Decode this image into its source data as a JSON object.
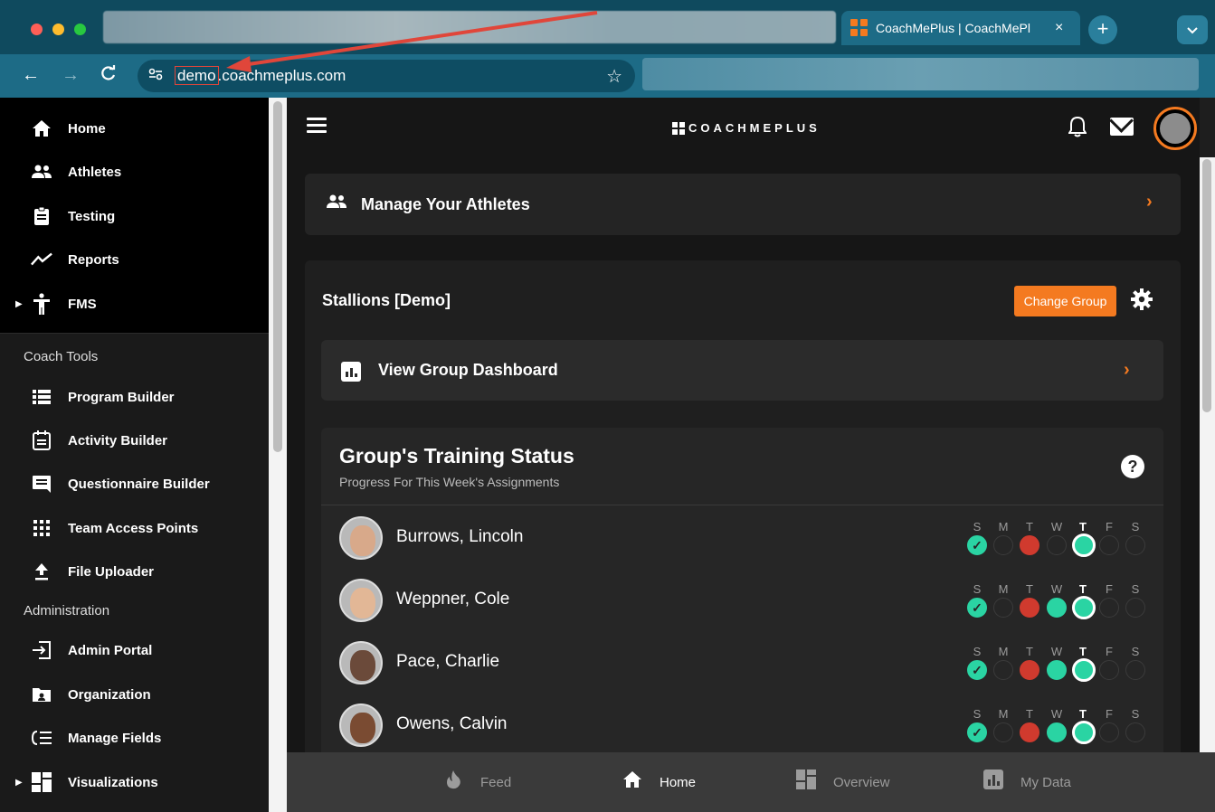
{
  "browser": {
    "tab_title": "CoachMePlus | CoachMePl",
    "tab_close": "×",
    "new_tab": "+",
    "tab_menu": "⌄",
    "url_highlight": "demo",
    "url_rest": ".coachmeplus.com",
    "back": "←",
    "forward": "→",
    "reload": "C",
    "site_info_icon": "⚯",
    "bookmark_icon": "☆"
  },
  "sidebar": {
    "items": [
      {
        "label": "Home",
        "icon": "home-icon"
      },
      {
        "label": "Athletes",
        "icon": "people-icon"
      },
      {
        "label": "Testing",
        "icon": "clipboard-icon"
      },
      {
        "label": "Reports",
        "icon": "trend-icon"
      },
      {
        "label": "FMS",
        "icon": "person-icon"
      }
    ],
    "section_coach": "Coach Tools",
    "coach_items": [
      {
        "label": "Program Builder",
        "icon": "list-icon"
      },
      {
        "label": "Activity Builder",
        "icon": "calendar-icon"
      },
      {
        "label": "Questionnaire Builder",
        "icon": "message-icon"
      },
      {
        "label": "Team Access Points",
        "icon": "grid-icon"
      },
      {
        "label": "File Uploader",
        "icon": "upload-icon"
      }
    ],
    "section_admin": "Administration",
    "admin_items": [
      {
        "label": "Admin Portal",
        "icon": "login-icon"
      },
      {
        "label": "Organization",
        "icon": "folder-icon"
      },
      {
        "label": "Manage Fields",
        "icon": "fields-icon"
      },
      {
        "label": "Visualizations",
        "icon": "dashboard-icon"
      }
    ]
  },
  "header": {
    "brand": "COACHMEPLUS"
  },
  "manage": {
    "label": "Manage Your Athletes",
    "chevron": "›"
  },
  "group": {
    "title": "Stallions [Demo]",
    "change_button": "Change Group",
    "dashboard_label": "View Group Dashboard",
    "chevron": "›"
  },
  "training": {
    "title": "Group's Training Status",
    "subtitle": "Progress For This Week's Assignments",
    "help": "?",
    "day_letters": [
      "S",
      "M",
      "T",
      "W",
      "T",
      "F",
      "S"
    ],
    "today_index": 4,
    "athletes": [
      {
        "name": "Burrows, Lincoln",
        "status": [
          "check",
          "empty",
          "red",
          "empty",
          "today",
          "empty",
          "empty"
        ],
        "skin": "#d8a98a"
      },
      {
        "name": "Weppner, Cole",
        "status": [
          "check",
          "empty",
          "red",
          "green",
          "today",
          "empty",
          "empty"
        ],
        "skin": "#e2b796"
      },
      {
        "name": "Pace, Charlie",
        "status": [
          "check",
          "empty",
          "red",
          "green",
          "today",
          "empty",
          "empty"
        ],
        "skin": "#6b4a3a"
      },
      {
        "name": "Owens, Calvin",
        "status": [
          "check",
          "empty",
          "red",
          "green",
          "today",
          "empty",
          "empty"
        ],
        "skin": "#7a4b32"
      }
    ]
  },
  "bottom_nav": [
    {
      "label": "Feed",
      "icon": "flame-icon"
    },
    {
      "label": "Home",
      "icon": "home-icon"
    },
    {
      "label": "Overview",
      "icon": "dashboard-icon"
    },
    {
      "label": "My Data",
      "icon": "bar-chart-icon"
    }
  ],
  "bottom_nav_active": 1,
  "colors": {
    "accent": "#f47a20",
    "complete": "#2ad4a3",
    "missed": "#d03a2e"
  }
}
